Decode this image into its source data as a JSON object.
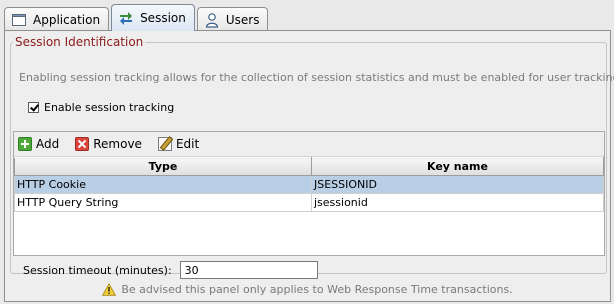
{
  "tabs": [
    {
      "label": "Application",
      "icon": "application-window-icon",
      "active": false
    },
    {
      "label": "Session",
      "icon": "session-arrows-icon",
      "active": true
    },
    {
      "label": "Users",
      "icon": "users-icon",
      "active": false
    }
  ],
  "group": {
    "legend": "Session Identification",
    "description": "Enabling session tracking allows for the collection of session statistics and must be enabled for user tracking.",
    "enable_label": "Enable session tracking",
    "enable_checked": true
  },
  "toolbar": {
    "add_label": "Add",
    "remove_label": "Remove",
    "edit_label": "Edit"
  },
  "table": {
    "columns": [
      "Type",
      "Key name"
    ],
    "rows": [
      {
        "type": "HTTP Cookie",
        "key": "JSESSIONID",
        "selected": true
      },
      {
        "type": "HTTP Query String",
        "key": "jsessionid",
        "selected": false
      }
    ]
  },
  "timeout": {
    "label": "Session timeout (minutes):",
    "value": "30"
  },
  "advice": "Be advised this panel only applies to Web Response Time transactions.",
  "colors": {
    "legend_text": "#8c1a1a",
    "selected_row": "#b8cfe5",
    "description_text": "#7b7b7b"
  }
}
